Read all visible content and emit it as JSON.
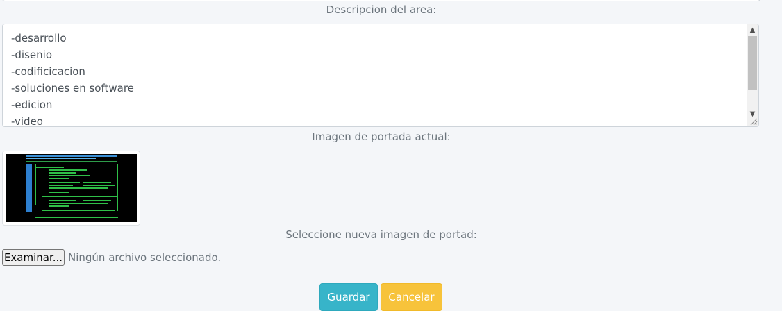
{
  "form": {
    "description_label": "Descripcion del area:",
    "description_lines": [
      "-desarrollo",
      "-disenio",
      "-codificicacion",
      "-soluciones en software",
      "-edicion",
      "-video"
    ],
    "current_cover_label": "Imagen de portada actual:",
    "new_cover_label": "Seleccione nueva imagen de portad:",
    "file_button_label": "Examinar...",
    "file_status": "Ningún archivo seleccionado.",
    "save_label": "Guardar",
    "cancel_label": "Cancelar"
  },
  "colors": {
    "save": "#37b4c9",
    "cancel": "#f7c33b",
    "text_muted": "#6c757d"
  }
}
